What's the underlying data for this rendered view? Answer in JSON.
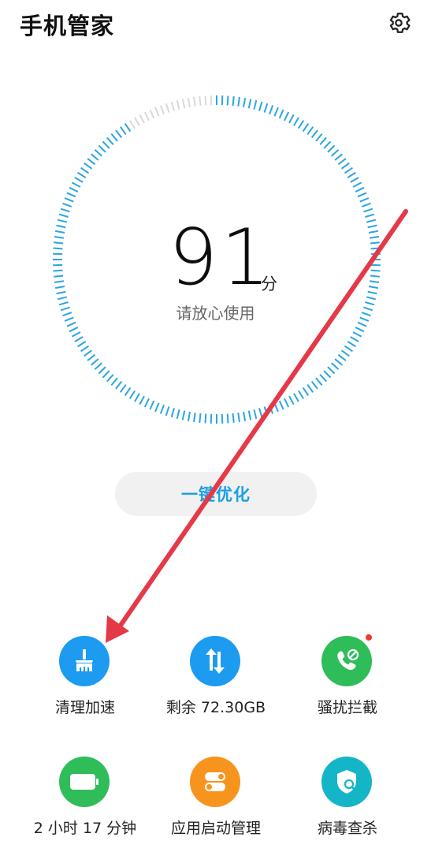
{
  "header": {
    "title": "手机管家",
    "settings_icon": "gear-icon"
  },
  "score": {
    "value": "91",
    "unit": "分",
    "status": "请放心使用",
    "accent": "#2aa6e0",
    "track": "#d9d9d9",
    "progress_fraction": 0.91
  },
  "optimize": {
    "label": "一键优化",
    "color": "#1aa0e6"
  },
  "features": [
    {
      "label": "清理加速",
      "icon": "broom-icon",
      "color": "#1d9bf0"
    },
    {
      "label": "剩余 72.30GB",
      "icon": "transfer-arrows-icon",
      "color": "#1d9bf0"
    },
    {
      "label": "骚扰拦截",
      "icon": "phone-block-icon",
      "color": "#2ebd59",
      "badge": true
    },
    {
      "label": "2 小时 17 分钟",
      "icon": "battery-icon",
      "color": "#2ebd59"
    },
    {
      "label": "应用启动管理",
      "icon": "toggle-icon",
      "color": "#f7941d"
    },
    {
      "label": "病毒查杀",
      "icon": "shield-scan-icon",
      "color": "#15b5c8"
    }
  ],
  "annotation": {
    "arrow_color": "#e53947"
  }
}
